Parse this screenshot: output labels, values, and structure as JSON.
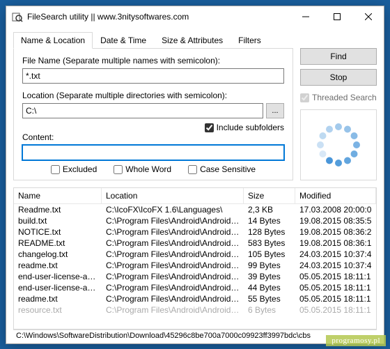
{
  "window": {
    "title": "FileSearch utility || www.3nitysoftwares.com"
  },
  "tabs": {
    "name_location": "Name & Location",
    "date_time": "Date & Time",
    "size_attributes": "Size & Attributes",
    "filters": "Filters"
  },
  "form": {
    "filename_label": "File Name (Separate multiple names with semicolon):",
    "filename_value": "*.txt",
    "location_label": "Location (Separate multiple directories with semicolon):",
    "location_value": "C:\\",
    "browse_label": "...",
    "include_subfolders": "Include subfolders",
    "include_subfolders_checked": true,
    "content_label": "Content:",
    "content_value": "",
    "excluded": "Excluded",
    "whole_word": "Whole Word",
    "case_sensitive": "Case Sensitive"
  },
  "side": {
    "find": "Find",
    "stop": "Stop",
    "threaded": "Threaded Search",
    "threaded_checked": true
  },
  "columns": {
    "name": "Name",
    "location": "Location",
    "size": "Size",
    "modified": "Modified"
  },
  "rows": [
    {
      "name": "Readme.txt",
      "location": "C:\\IcoFX\\IcoFX 1.6\\Languages\\",
      "size": "2,3 KB",
      "modified": "17.03.2008 20:00:0"
    },
    {
      "name": "build.txt",
      "location": "C:\\Program Files\\Android\\Android St...",
      "size": "14 Bytes",
      "modified": "19.08.2015 08:35:5"
    },
    {
      "name": "NOTICE.txt",
      "location": "C:\\Program Files\\Android\\Android St...",
      "size": "128 Bytes",
      "modified": "19.08.2015 08:36:2"
    },
    {
      "name": "README.txt",
      "location": "C:\\Program Files\\Android\\Android St...",
      "size": "583 Bytes",
      "modified": "19.08.2015 08:36:1"
    },
    {
      "name": "changelog.txt",
      "location": "C:\\Program Files\\Android\\Android St...",
      "size": "105 Bytes",
      "modified": "24.03.2015 10:37:4"
    },
    {
      "name": "readme.txt",
      "location": "C:\\Program Files\\Android\\Android St...",
      "size": "99 Bytes",
      "modified": "24.03.2015 10:37:4"
    },
    {
      "name": "end-user-license-agre...",
      "location": "C:\\Program Files\\Android\\Android St...",
      "size": "39 Bytes",
      "modified": "05.05.2015 18:11:1"
    },
    {
      "name": "end-user-license-agre...",
      "location": "C:\\Program Files\\Android\\Android St...",
      "size": "44 Bytes",
      "modified": "05.05.2015 18:11:1"
    },
    {
      "name": "readme.txt",
      "location": "C:\\Program Files\\Android\\Android St...",
      "size": "55 Bytes",
      "modified": "05.05.2015 18:11:1"
    },
    {
      "name": "resource.txt",
      "location": "C:\\Program Files\\Android\\Android St...",
      "size": "6 Bytes",
      "modified": "05.05.2015 18:11:1"
    }
  ],
  "statusbar": "C:\\Windows\\SoftwareDistribution\\Download\\45296c8be700a7000c09923ff3997bdc\\cbs",
  "watermark": "programosy.pl"
}
